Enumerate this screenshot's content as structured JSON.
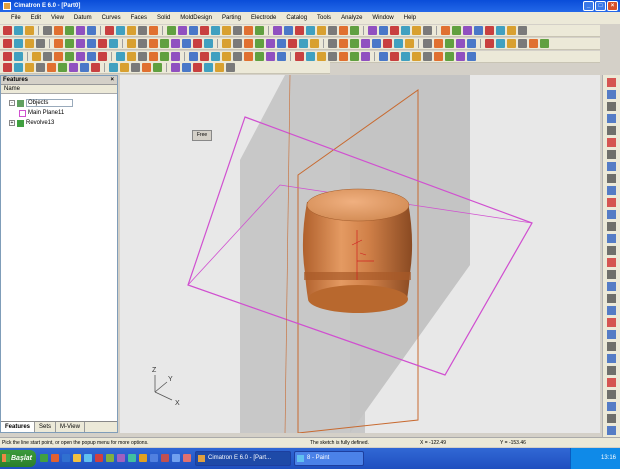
{
  "window": {
    "title": "Cimatron E 6.0 - [Part0]"
  },
  "menu": [
    "File",
    "Edit",
    "View",
    "Datum",
    "Curves",
    "Faces",
    "Solid",
    "MoldDesign",
    "Parting",
    "Electrode",
    "Catalog",
    "Tools",
    "Analyze",
    "Window",
    "Help"
  ],
  "panel": {
    "title": "Features",
    "column": "Name",
    "tree": [
      {
        "label": "Objects",
        "selected": true
      },
      {
        "label": "Main Plane11",
        "selected": false
      },
      {
        "label": "Revolve13",
        "selected": false
      }
    ],
    "tabs": [
      "Features",
      "Sets",
      "M-View"
    ]
  },
  "viewport": {
    "float_button": "Free",
    "triad": {
      "x": "X",
      "y": "Y",
      "z": "Z"
    }
  },
  "status": {
    "hint": "Pick the line start point, or open the popup menu for more options.",
    "sketch": "The sketch is fully defined.",
    "x": "X = -122.49",
    "y": "Y = -153.46"
  },
  "taskbar": {
    "start": "Başlat",
    "tasks": [
      "Cimatron E 6.0 - [Part...",
      "8 - Paint"
    ],
    "clock": "13:16"
  },
  "colors": {
    "part": "#d98a50",
    "plane_magenta": "#d050d0",
    "plane_orange": "#c86a30",
    "plane_gray": "#c4c4c4"
  }
}
